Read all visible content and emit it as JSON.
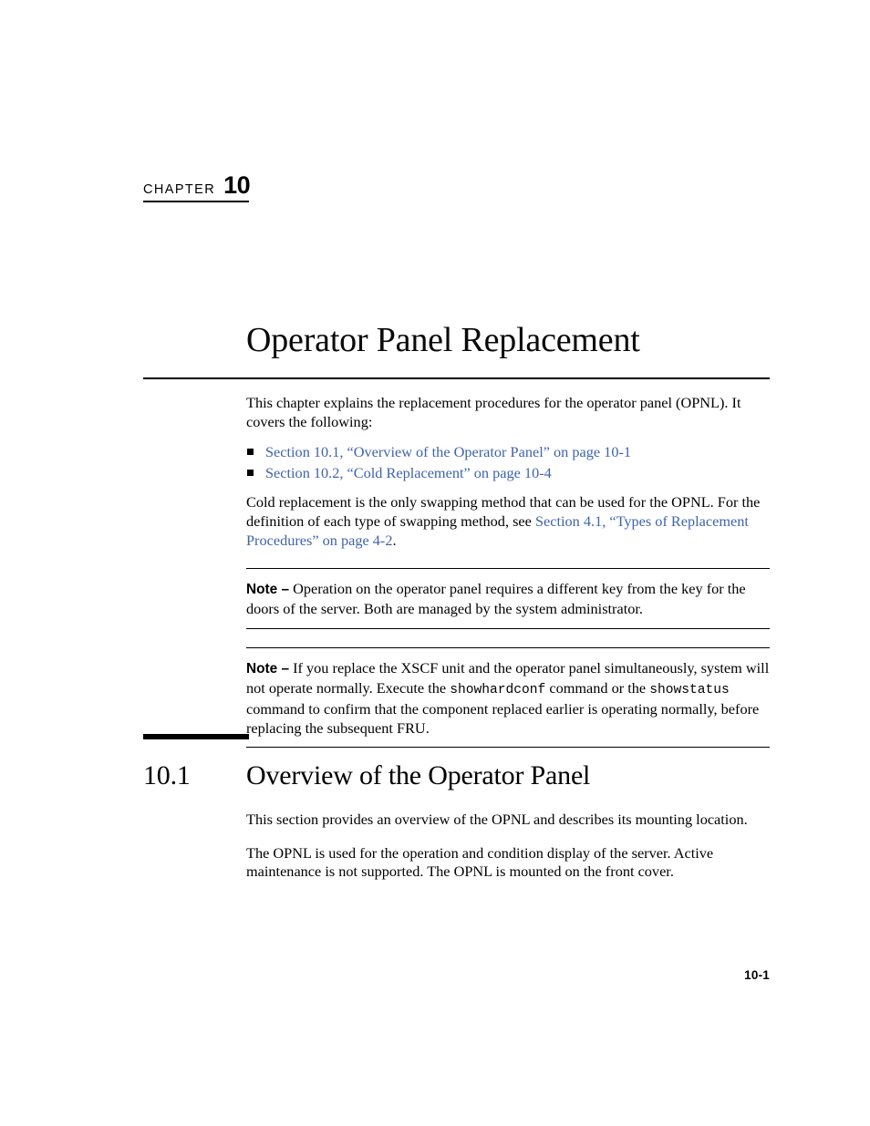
{
  "chapter": {
    "word": "CHAPTER",
    "number": "10",
    "title": "Operator Panel Replacement"
  },
  "intro": {
    "paragraph": "This chapter explains the replacement procedures for the operator panel (OPNL). It covers the following:",
    "bullets": [
      "Section 10.1, “Overview of the Operator Panel” on page 10-1",
      "Section 10.2, “Cold Replacement” on page 10-4"
    ],
    "cold_replacement": {
      "text_before": "Cold replacement is the only swapping method that can be used for the OPNL. For the definition of each type of swapping method, see ",
      "link": "Section 4.1, “Types of Replacement Procedures” on page 4-2",
      "text_after": "."
    }
  },
  "notes": [
    {
      "label": "Note –",
      "segments": [
        {
          "type": "text",
          "value": " Operation on the operator panel requires a different key from the key for the doors of the server. Both are managed by the system administrator."
        }
      ]
    },
    {
      "label": "Note –",
      "segments": [
        {
          "type": "text",
          "value": " If you replace the XSCF unit and the operator panel simultaneously, system will not operate normally. Execute the "
        },
        {
          "type": "code",
          "value": "showhardconf"
        },
        {
          "type": "text",
          "value": " command or the "
        },
        {
          "type": "code",
          "value": "showstatus"
        },
        {
          "type": "text",
          "value": " command to confirm that the component replaced earlier is operating normally, before replacing the subsequent FRU."
        }
      ]
    }
  ],
  "section": {
    "number": "10.1",
    "title": "Overview of the Operator Panel",
    "paragraphs": [
      "This section provides an overview of the OPNL and describes its mounting location.",
      "The OPNL is used for the operation and condition display of the server. Active maintenance is not supported. The OPNL is mounted on the front cover."
    ]
  },
  "footer": {
    "page_number": "10-1"
  },
  "colors": {
    "link": "#3f63ab",
    "text": "#000000",
    "background": "#ffffff"
  }
}
